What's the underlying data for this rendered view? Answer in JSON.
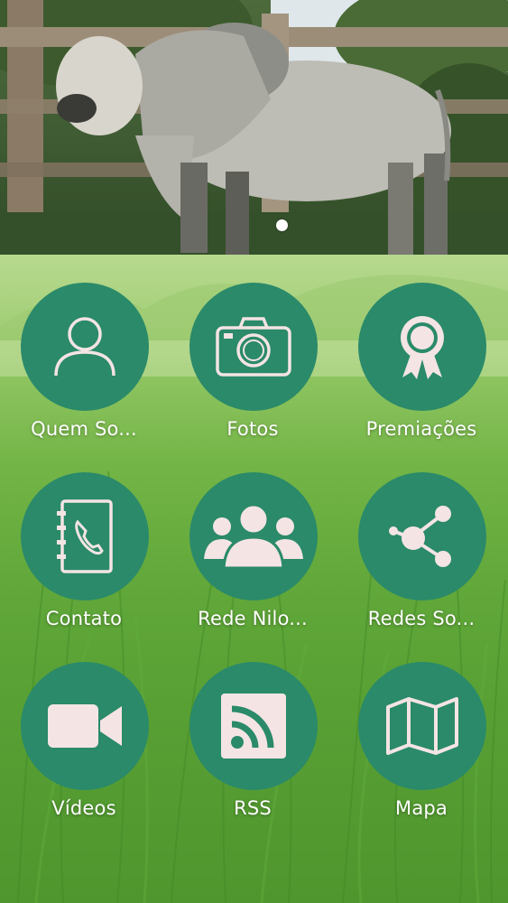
{
  "hero": {
    "image_icon": "zebu-bull-photo",
    "pager_active_index": 0
  },
  "menu": [
    {
      "label": "Quem So...",
      "icon": "person-icon"
    },
    {
      "label": "Fotos",
      "icon": "camera-icon"
    },
    {
      "label": "Premiações",
      "icon": "award-ribbon-icon"
    },
    {
      "label": "Contato",
      "icon": "address-book-phone-icon"
    },
    {
      "label": "Rede Nilo...",
      "icon": "group-people-icon"
    },
    {
      "label": "Redes So...",
      "icon": "share-icon"
    },
    {
      "label": "Vídeos",
      "icon": "video-camera-icon"
    },
    {
      "label": "RSS",
      "icon": "rss-icon"
    },
    {
      "label": "Mapa",
      "icon": "map-icon"
    }
  ],
  "colors": {
    "circle": "#2a8a6a",
    "icon_fill": "#f4e4e4",
    "label": "#ffffff",
    "grass": "#62a83a"
  }
}
